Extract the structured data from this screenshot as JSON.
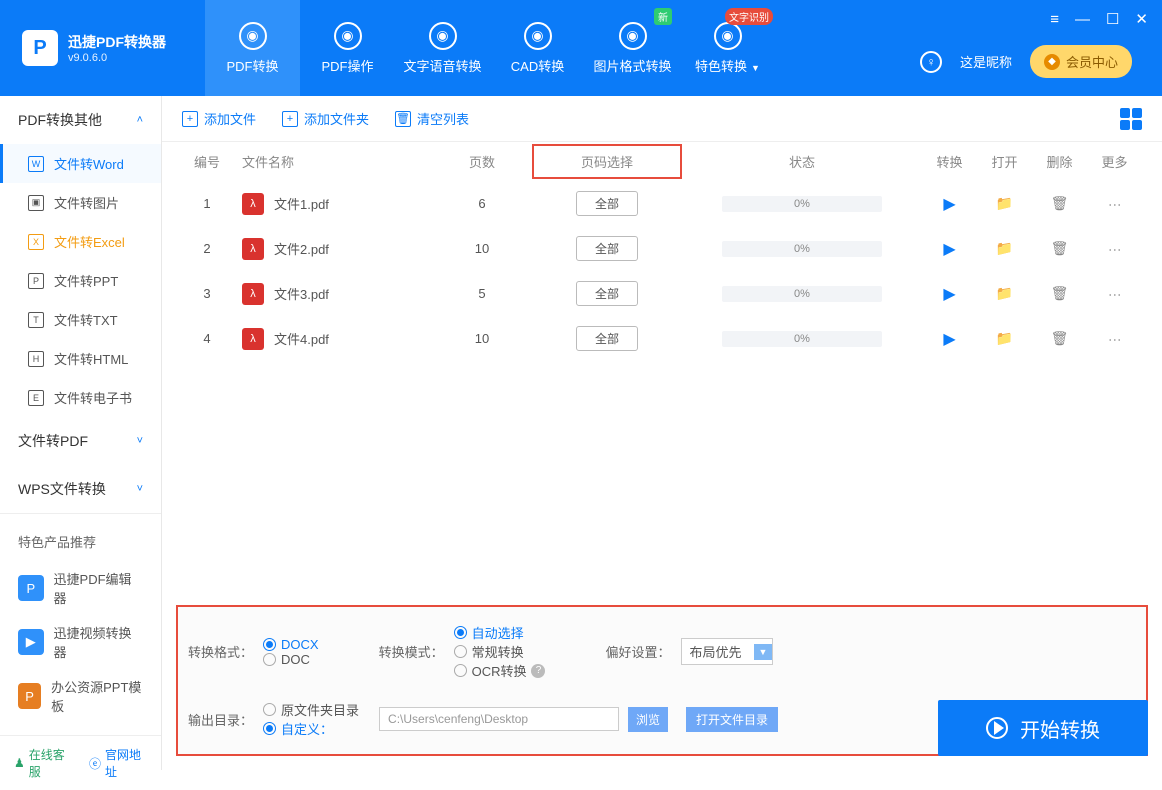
{
  "app": {
    "name": "迅捷PDF转换器",
    "version": "v9.0.6.0"
  },
  "topTabs": [
    {
      "label": "PDF转换",
      "active": true
    },
    {
      "label": "PDF操作"
    },
    {
      "label": "文字语音转换"
    },
    {
      "label": "CAD转换"
    },
    {
      "label": "图片格式转换",
      "badge_new": "新"
    },
    {
      "label": "特色转换",
      "badge_text": "文字识别",
      "dropdown": true
    }
  ],
  "user": {
    "nickname": "这是昵称",
    "vip_label": "会员中心"
  },
  "sidebar": {
    "groups": [
      {
        "title": "PDF转换其他",
        "expanded": true,
        "items": [
          {
            "label": "文件转Word",
            "icon": "W",
            "active": true
          },
          {
            "label": "文件转图片",
            "icon": "▣"
          },
          {
            "label": "文件转Excel",
            "icon": "X",
            "highlight": true
          },
          {
            "label": "文件转PPT",
            "icon": "P"
          },
          {
            "label": "文件转TXT",
            "icon": "T"
          },
          {
            "label": "文件转HTML",
            "icon": "H"
          },
          {
            "label": "文件转电子书",
            "icon": "E"
          }
        ]
      },
      {
        "title": "文件转PDF",
        "expanded": false
      },
      {
        "title": "WPS文件转换",
        "expanded": false
      }
    ],
    "promo_title": "特色产品推荐",
    "promos": [
      {
        "label": "迅捷PDF编辑器",
        "color": "#2f91fa",
        "ic": "P"
      },
      {
        "label": "迅捷视频转换器",
        "color": "#2f91fa",
        "ic": "▶"
      },
      {
        "label": "办公资源PPT模板",
        "color": "#e67e22",
        "ic": "P"
      }
    ],
    "footer": {
      "service": "在线客服",
      "site": "官网地址"
    }
  },
  "toolbar": {
    "add_file": "添加文件",
    "add_folder": "添加文件夹",
    "clear": "清空列表"
  },
  "table": {
    "headers": {
      "idx": "编号",
      "name": "文件名称",
      "pages": "页数",
      "range": "页码选择",
      "status": "状态",
      "convert": "转换",
      "open": "打开",
      "delete": "删除",
      "more": "更多"
    },
    "rows": [
      {
        "idx": "1",
        "name": "文件1.pdf",
        "pages": "6",
        "range": "全部",
        "status": "0%"
      },
      {
        "idx": "2",
        "name": "文件2.pdf",
        "pages": "10",
        "range": "全部",
        "status": "0%"
      },
      {
        "idx": "3",
        "name": "文件3.pdf",
        "pages": "5",
        "range": "全部",
        "status": "0%"
      },
      {
        "idx": "4",
        "name": "文件4.pdf",
        "pages": "10",
        "range": "全部",
        "status": "0%"
      }
    ]
  },
  "settings": {
    "format_label": "转换格式：",
    "formats": [
      {
        "label": "DOCX",
        "on": true
      },
      {
        "label": "DOC",
        "on": false
      }
    ],
    "mode_label": "转换模式：",
    "modes": [
      {
        "label": "自动选择",
        "on": true
      },
      {
        "label": "常规转换",
        "on": false
      },
      {
        "label": "OCR转换",
        "on": false,
        "help": true
      }
    ],
    "pref_label": "偏好设置：",
    "pref_value": "布局优先",
    "output_label": "输出目录：",
    "output_opts": [
      {
        "label": "原文件夹目录",
        "on": false
      },
      {
        "label": "自定义：",
        "on": true
      }
    ],
    "path": "C:\\Users\\cenfeng\\Desktop",
    "browse": "浏览",
    "open_dir": "打开文件目录"
  },
  "start_label": "开始转换"
}
